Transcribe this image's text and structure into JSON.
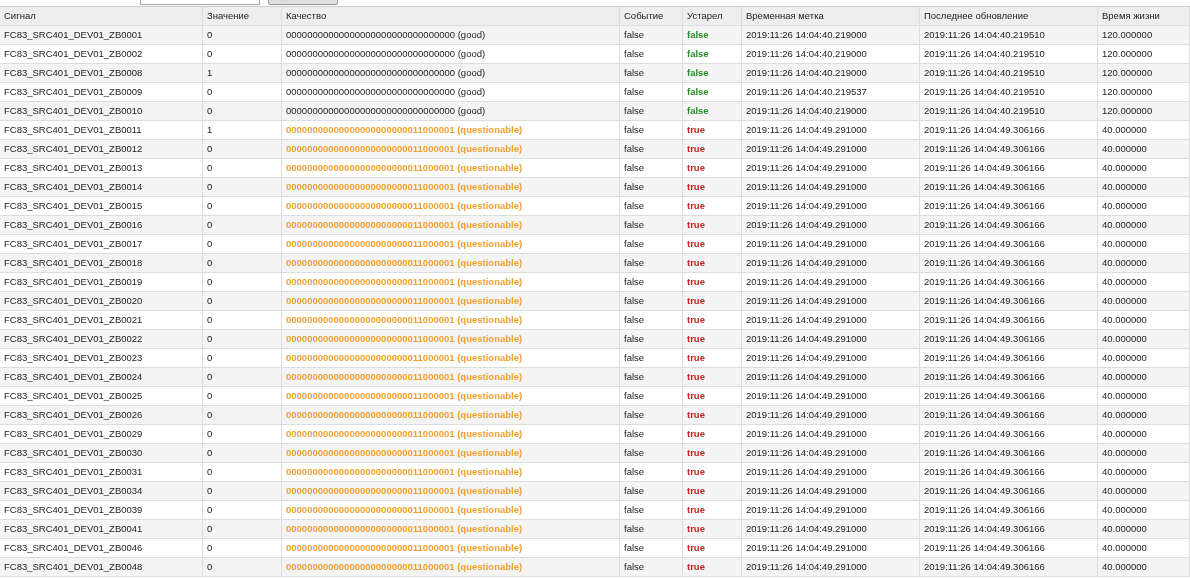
{
  "toolbar": {
    "field": {
      "kind": "input"
    },
    "button": {
      "kind": "button"
    }
  },
  "table": {
    "columns": [
      "Сигнал",
      "Значение",
      "Качество",
      "Событие",
      "Устарел",
      "Временная метка",
      "Последнее обновление",
      "Время жизни"
    ],
    "rows": [
      {
        "questionable": false,
        "cells": [
          "FC83_SRC401_DEV01_ZB0001",
          "0",
          "00000000000000000000000000000000 (good)",
          "false",
          "false",
          "2019:11:26 14:04:40.219000",
          "2019:11:26 14:04:40.219510",
          "120.000000"
        ]
      },
      {
        "questionable": false,
        "cells": [
          "FC83_SRC401_DEV01_ZB0002",
          "0",
          "00000000000000000000000000000000 (good)",
          "false",
          "false",
          "2019:11:26 14:04:40.219000",
          "2019:11:26 14:04:40.219510",
          "120.000000"
        ]
      },
      {
        "questionable": false,
        "cells": [
          "FC83_SRC401_DEV01_ZB0008",
          "1",
          "00000000000000000000000000000000 (good)",
          "false",
          "false",
          "2019:11:26 14:04:40.219000",
          "2019:11:26 14:04:40.219510",
          "120.000000"
        ]
      },
      {
        "questionable": false,
        "cells": [
          "FC83_SRC401_DEV01_ZB0009",
          "0",
          "00000000000000000000000000000000 (good)",
          "false",
          "false",
          "2019:11:26 14:04:40.219537",
          "2019:11:26 14:04:40.219510",
          "120.000000"
        ]
      },
      {
        "questionable": false,
        "cells": [
          "FC83_SRC401_DEV01_ZB0010",
          "0",
          "00000000000000000000000000000000 (good)",
          "false",
          "false",
          "2019:11:26 14:04:40.219000",
          "2019:11:26 14:04:40.219510",
          "120.000000"
        ]
      },
      {
        "questionable": true,
        "cells": [
          "FC83_SRC401_DEV01_ZB0011",
          "1",
          "00000000000000000000000011000001 (questionable)",
          "false",
          "true",
          "2019:11:26 14:04:49.291000",
          "2019:11:26 14:04:49.306166",
          "40.000000"
        ]
      },
      {
        "questionable": true,
        "cells": [
          "FC83_SRC401_DEV01_ZB0012",
          "0",
          "00000000000000000000000011000001 (questionable)",
          "false",
          "true",
          "2019:11:26 14:04:49.291000",
          "2019:11:26 14:04:49.306166",
          "40.000000"
        ]
      },
      {
        "questionable": true,
        "cells": [
          "FC83_SRC401_DEV01_ZB0013",
          "0",
          "00000000000000000000000011000001 (questionable)",
          "false",
          "true",
          "2019:11:26 14:04:49.291000",
          "2019:11:26 14:04:49.306166",
          "40.000000"
        ]
      },
      {
        "questionable": true,
        "cells": [
          "FC83_SRC401_DEV01_ZB0014",
          "0",
          "00000000000000000000000011000001 (questionable)",
          "false",
          "true",
          "2019:11:26 14:04:49.291000",
          "2019:11:26 14:04:49.306166",
          "40.000000"
        ]
      },
      {
        "questionable": true,
        "cells": [
          "FC83_SRC401_DEV01_ZB0015",
          "0",
          "00000000000000000000000011000001 (questionable)",
          "false",
          "true",
          "2019:11:26 14:04:49.291000",
          "2019:11:26 14:04:49.306166",
          "40.000000"
        ]
      },
      {
        "questionable": true,
        "cells": [
          "FC83_SRC401_DEV01_ZB0016",
          "0",
          "00000000000000000000000011000001 (questionable)",
          "false",
          "true",
          "2019:11:26 14:04:49.291000",
          "2019:11:26 14:04:49.306166",
          "40.000000"
        ]
      },
      {
        "questionable": true,
        "cells": [
          "FC83_SRC401_DEV01_ZB0017",
          "0",
          "00000000000000000000000011000001 (questionable)",
          "false",
          "true",
          "2019:11:26 14:04:49.291000",
          "2019:11:26 14:04:49.306166",
          "40.000000"
        ]
      },
      {
        "questionable": true,
        "cells": [
          "FC83_SRC401_DEV01_ZB0018",
          "0",
          "00000000000000000000000011000001 (questionable)",
          "false",
          "true",
          "2019:11:26 14:04:49.291000",
          "2019:11:26 14:04:49.306166",
          "40.000000"
        ]
      },
      {
        "questionable": true,
        "cells": [
          "FC83_SRC401_DEV01_ZB0019",
          "0",
          "00000000000000000000000011000001 (questionable)",
          "false",
          "true",
          "2019:11:26 14:04:49.291000",
          "2019:11:26 14:04:49.306166",
          "40.000000"
        ]
      },
      {
        "questionable": true,
        "cells": [
          "FC83_SRC401_DEV01_ZB0020",
          "0",
          "00000000000000000000000011000001 (questionable)",
          "false",
          "true",
          "2019:11:26 14:04:49.291000",
          "2019:11:26 14:04:49.306166",
          "40.000000"
        ]
      },
      {
        "questionable": true,
        "cells": [
          "FC83_SRC401_DEV01_ZB0021",
          "0",
          "00000000000000000000000011000001 (questionable)",
          "false",
          "true",
          "2019:11:26 14:04:49.291000",
          "2019:11:26 14:04:49.306166",
          "40.000000"
        ]
      },
      {
        "questionable": true,
        "cells": [
          "FC83_SRC401_DEV01_ZB0022",
          "0",
          "00000000000000000000000011000001 (questionable)",
          "false",
          "true",
          "2019:11:26 14:04:49.291000",
          "2019:11:26 14:04:49.306166",
          "40.000000"
        ]
      },
      {
        "questionable": true,
        "cells": [
          "FC83_SRC401_DEV01_ZB0023",
          "0",
          "00000000000000000000000011000001 (questionable)",
          "false",
          "true",
          "2019:11:26 14:04:49.291000",
          "2019:11:26 14:04:49.306166",
          "40.000000"
        ]
      },
      {
        "questionable": true,
        "cells": [
          "FC83_SRC401_DEV01_ZB0024",
          "0",
          "00000000000000000000000011000001 (questionable)",
          "false",
          "true",
          "2019:11:26 14:04:49.291000",
          "2019:11:26 14:04:49.306166",
          "40.000000"
        ]
      },
      {
        "questionable": true,
        "cells": [
          "FC83_SRC401_DEV01_ZB0025",
          "0",
          "00000000000000000000000011000001 (questionable)",
          "false",
          "true",
          "2019:11:26 14:04:49.291000",
          "2019:11:26 14:04:49.306166",
          "40.000000"
        ]
      },
      {
        "questionable": true,
        "cells": [
          "FC83_SRC401_DEV01_ZB0026",
          "0",
          "00000000000000000000000011000001 (questionable)",
          "false",
          "true",
          "2019:11:26 14:04:49.291000",
          "2019:11:26 14:04:49.306166",
          "40.000000"
        ]
      },
      {
        "questionable": true,
        "cells": [
          "FC83_SRC401_DEV01_ZB0029",
          "0",
          "00000000000000000000000011000001 (questionable)",
          "false",
          "true",
          "2019:11:26 14:04:49.291000",
          "2019:11:26 14:04:49.306166",
          "40.000000"
        ]
      },
      {
        "questionable": true,
        "cells": [
          "FC83_SRC401_DEV01_ZB0030",
          "0",
          "00000000000000000000000011000001 (questionable)",
          "false",
          "true",
          "2019:11:26 14:04:49.291000",
          "2019:11:26 14:04:49.306166",
          "40.000000"
        ]
      },
      {
        "questionable": true,
        "cells": [
          "FC83_SRC401_DEV01_ZB0031",
          "0",
          "00000000000000000000000011000001 (questionable)",
          "false",
          "true",
          "2019:11:26 14:04:49.291000",
          "2019:11:26 14:04:49.306166",
          "40.000000"
        ]
      },
      {
        "questionable": true,
        "cells": [
          "FC83_SRC401_DEV01_ZB0034",
          "0",
          "00000000000000000000000011000001 (questionable)",
          "false",
          "true",
          "2019:11:26 14:04:49.291000",
          "2019:11:26 14:04:49.306166",
          "40.000000"
        ]
      },
      {
        "questionable": true,
        "cells": [
          "FC83_SRC401_DEV01_ZB0039",
          "0",
          "00000000000000000000000011000001 (questionable)",
          "false",
          "true",
          "2019:11:26 14:04:49.291000",
          "2019:11:26 14:04:49.306166",
          "40.000000"
        ]
      },
      {
        "questionable": true,
        "cells": [
          "FC83_SRC401_DEV01_ZB0041",
          "0",
          "00000000000000000000000011000001 (questionable)",
          "false",
          "true",
          "2019:11:26 14:04:49.291000",
          "2019:11:26 14:04:49.306166",
          "40.000000"
        ]
      },
      {
        "questionable": true,
        "cells": [
          "FC83_SRC401_DEV01_ZB0046",
          "0",
          "00000000000000000000000011000001 (questionable)",
          "false",
          "true",
          "2019:11:26 14:04:49.291000",
          "2019:11:26 14:04:49.306166",
          "40.000000"
        ]
      },
      {
        "questionable": true,
        "cells": [
          "FC83_SRC401_DEV01_ZB0048",
          "0",
          "00000000000000000000000011000001 (questionable)",
          "false",
          "true",
          "2019:11:26 14:04:49.291000",
          "2019:11:26 14:04:49.306166",
          "40.000000"
        ]
      }
    ]
  }
}
